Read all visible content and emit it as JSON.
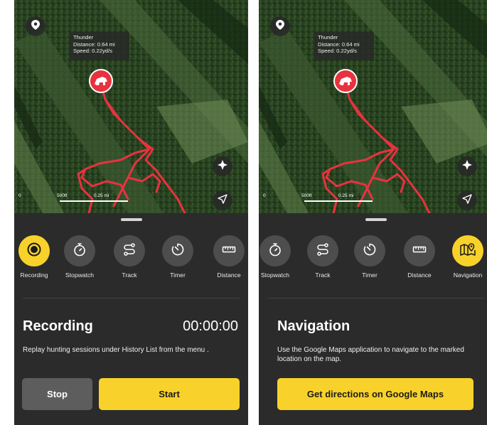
{
  "map": {
    "info": {
      "name": "Thunder",
      "distance": "Distance: 0.64 mi",
      "speed": "Speed: 0.22yd/s"
    },
    "scale": {
      "zero": "0",
      "mid": "500ft",
      "end": "0.25 mi"
    }
  },
  "left": {
    "tools": [
      {
        "label": "Recording",
        "icon": "record-icon",
        "active": true
      },
      {
        "label": "Stopwatch",
        "icon": "stopwatch-icon",
        "active": false
      },
      {
        "label": "Track",
        "icon": "track-icon",
        "active": false
      },
      {
        "label": "Timer",
        "icon": "timer-icon",
        "active": false
      },
      {
        "label": "Distance",
        "icon": "ruler-icon",
        "active": false
      }
    ],
    "title": "Recording",
    "timer": "00:00:00",
    "description": "Replay hunting sessions under History List from the menu .",
    "stop_label": "Stop",
    "start_label": "Start"
  },
  "right": {
    "tools": [
      {
        "label": "Stopwatch",
        "icon": "stopwatch-icon",
        "active": false
      },
      {
        "label": "Track",
        "icon": "track-icon",
        "active": false
      },
      {
        "label": "Timer",
        "icon": "timer-icon",
        "active": false
      },
      {
        "label": "Distance",
        "icon": "ruler-icon",
        "active": false
      },
      {
        "label": "Navigation",
        "icon": "map-pin-icon",
        "active": true
      }
    ],
    "title": "Navigation",
    "description": "Use the Google Maps application to navigate to the marked location on the map.",
    "directions_label": "Get directions on Google Maps"
  },
  "colors": {
    "accent": "#f8d22a",
    "sheet": "#2b2b2b",
    "tool_bg": "#4d4d4d",
    "track": "#e8323f"
  }
}
